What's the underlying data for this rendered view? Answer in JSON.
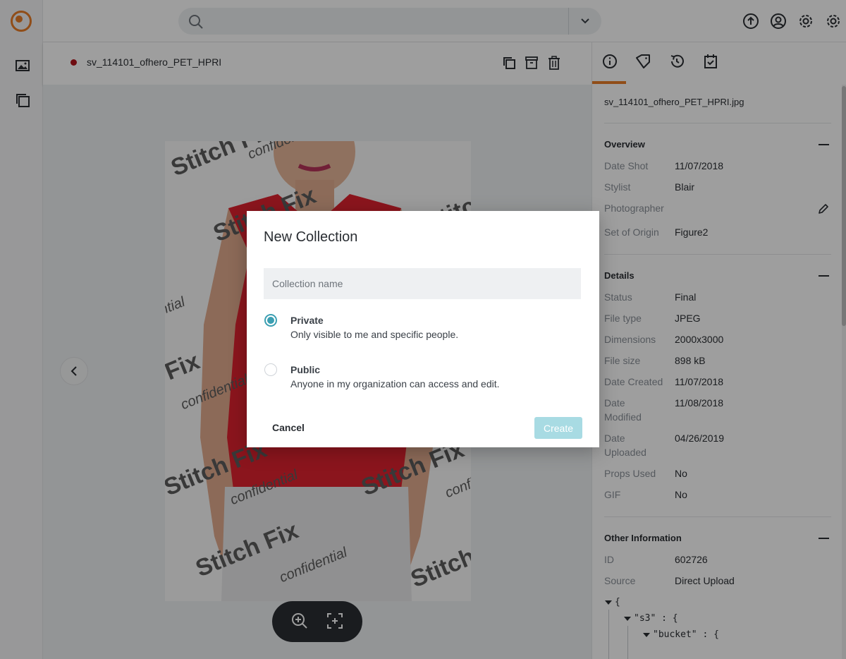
{
  "icons": {
    "logo": "app-logo-icon",
    "sidebar": [
      "images-icon",
      "collections-icon"
    ],
    "top": [
      "upload-icon",
      "user-icon",
      "settings-icon",
      "admin-settings-icon"
    ],
    "toolbar": [
      "duplicate-icon",
      "archive-icon",
      "trash-icon"
    ],
    "tabs": [
      "info-icon",
      "tags-icon",
      "history-icon",
      "calendar-check-icon"
    ]
  },
  "colors": {
    "accent": "#e97c27",
    "status_dot": "#b3141c",
    "radio_selected": "#3b9fb2",
    "create_disabled": "#a8dbe3"
  },
  "search": {
    "placeholder": ""
  },
  "toolbar": {
    "title": "sv_114101_ofhero_PET_HPRI"
  },
  "viewer": {
    "watermarks": [
      "Stitch Fix",
      "confidential"
    ]
  },
  "panel": {
    "filename": "sv_114101_ofhero_PET_HPRI.jpg",
    "overview": {
      "title": "Overview",
      "rows": [
        {
          "label": "Date Shot",
          "value": "11/07/2018"
        },
        {
          "label": "Stylist",
          "value": "Blair"
        },
        {
          "label": "Photographer",
          "value": ""
        },
        {
          "label": "Set of Origin",
          "value": "Figure2"
        }
      ]
    },
    "details": {
      "title": "Details",
      "rows": [
        {
          "label": "Status",
          "value": "Final"
        },
        {
          "label": "File type",
          "value": "JPEG"
        },
        {
          "label": "Dimensions",
          "value": "2000x3000"
        },
        {
          "label": "File size",
          "value": "898 kB"
        },
        {
          "label": "Date Created",
          "value": "11/07/2018"
        },
        {
          "label": "Date Modified",
          "value": "11/08/2018"
        },
        {
          "label": "Date Uploaded",
          "value": "04/26/2019"
        },
        {
          "label": "Props Used",
          "value": "No"
        },
        {
          "label": "GIF",
          "value": "No"
        }
      ]
    },
    "other": {
      "title": "Other Information",
      "rows": [
        {
          "label": "ID",
          "value": "602726"
        },
        {
          "label": "Source",
          "value": "Direct Upload"
        }
      ],
      "json_lines": [
        "{",
        "\"s3\" : {",
        "\"bucket\" : {"
      ]
    }
  },
  "modal": {
    "title": "New Collection",
    "input_placeholder": "Collection name",
    "options": [
      {
        "title": "Private",
        "desc": "Only visible to me and specific people.",
        "checked": true
      },
      {
        "title": "Public",
        "desc": "Anyone in my organization can access and edit.",
        "checked": false
      }
    ],
    "cancel_label": "Cancel",
    "create_label": "Create"
  }
}
